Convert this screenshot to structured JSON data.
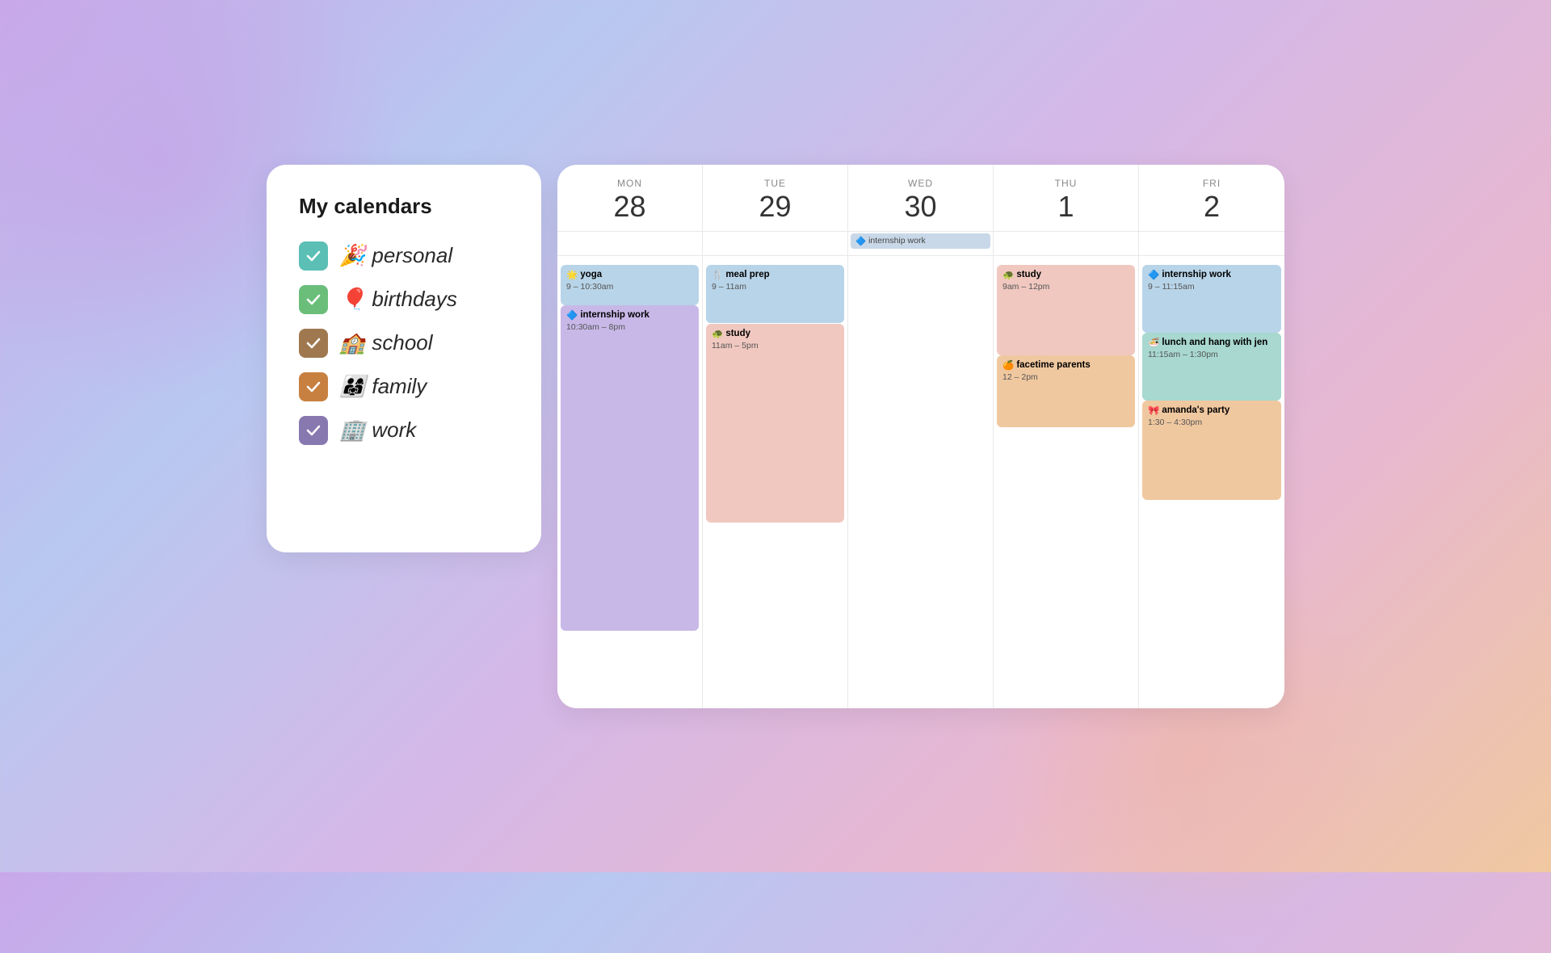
{
  "sidebar": {
    "title": "My calendars",
    "calendars": [
      {
        "id": "personal",
        "label": "personal",
        "emoji": "🎉",
        "color": "teal",
        "checked": true
      },
      {
        "id": "birthdays",
        "label": "birthdays",
        "emoji": "🎈",
        "color": "green",
        "checked": true
      },
      {
        "id": "school",
        "label": "school",
        "emoji": "🏫",
        "color": "brown",
        "checked": true
      },
      {
        "id": "family",
        "label": "family",
        "emoji": "👨‍👩‍👧‍👦",
        "color": "orange",
        "checked": true
      },
      {
        "id": "work",
        "label": "work",
        "emoji": "🏢",
        "color": "purple",
        "checked": true
      }
    ]
  },
  "calendar": {
    "days": [
      {
        "name": "MON",
        "number": "28"
      },
      {
        "name": "TUE",
        "number": "29"
      },
      {
        "name": "WED",
        "number": "30"
      },
      {
        "name": "THU",
        "number": "1"
      },
      {
        "name": "FRI",
        "number": "2"
      }
    ],
    "allday_events": [
      {
        "day": 2,
        "label": "internship work",
        "emoji": "🔷",
        "color": "blue"
      }
    ],
    "events": [
      {
        "day": 0,
        "title": "yoga",
        "time": "9 – 10:30am",
        "emoji": "🌟",
        "color": "blue",
        "top_pct": 0,
        "height_pct": 10
      },
      {
        "day": 0,
        "title": "internship work",
        "time": "10:30am – 8pm",
        "emoji": "🔷",
        "color": "purple",
        "top_pct": 10,
        "height_pct": 68
      },
      {
        "day": 1,
        "title": "meal prep",
        "time": "9 – 11am",
        "emoji": "🍴",
        "color": "blue",
        "top_pct": 0,
        "height_pct": 14
      },
      {
        "day": 1,
        "title": "study",
        "time": "11am – 5pm",
        "emoji": "🐢",
        "color": "pink",
        "top_pct": 14,
        "height_pct": 42
      },
      {
        "day": 3,
        "title": "study",
        "time": "9am – 12pm",
        "emoji": "🐢",
        "color": "pink",
        "top_pct": 0,
        "height_pct": 21
      },
      {
        "day": 3,
        "title": "facetime parents",
        "time": "12 – 2pm",
        "emoji": "🍊",
        "color": "orange",
        "top_pct": 21,
        "height_pct": 14
      },
      {
        "day": 4,
        "title": "internship work",
        "time": "9 – 11:15am",
        "emoji": "🔷",
        "color": "blue",
        "top_pct": 0,
        "height_pct": 16
      },
      {
        "day": 4,
        "title": "lunch and hang with jen",
        "time": "11:15am – 1:30pm",
        "emoji": "🍜",
        "color": "teal",
        "top_pct": 16,
        "height_pct": 16
      },
      {
        "day": 4,
        "title": "amanda's party",
        "time": "1:30 – 4:30pm",
        "emoji": "🎀",
        "color": "orange",
        "top_pct": 32,
        "height_pct": 21
      }
    ]
  }
}
